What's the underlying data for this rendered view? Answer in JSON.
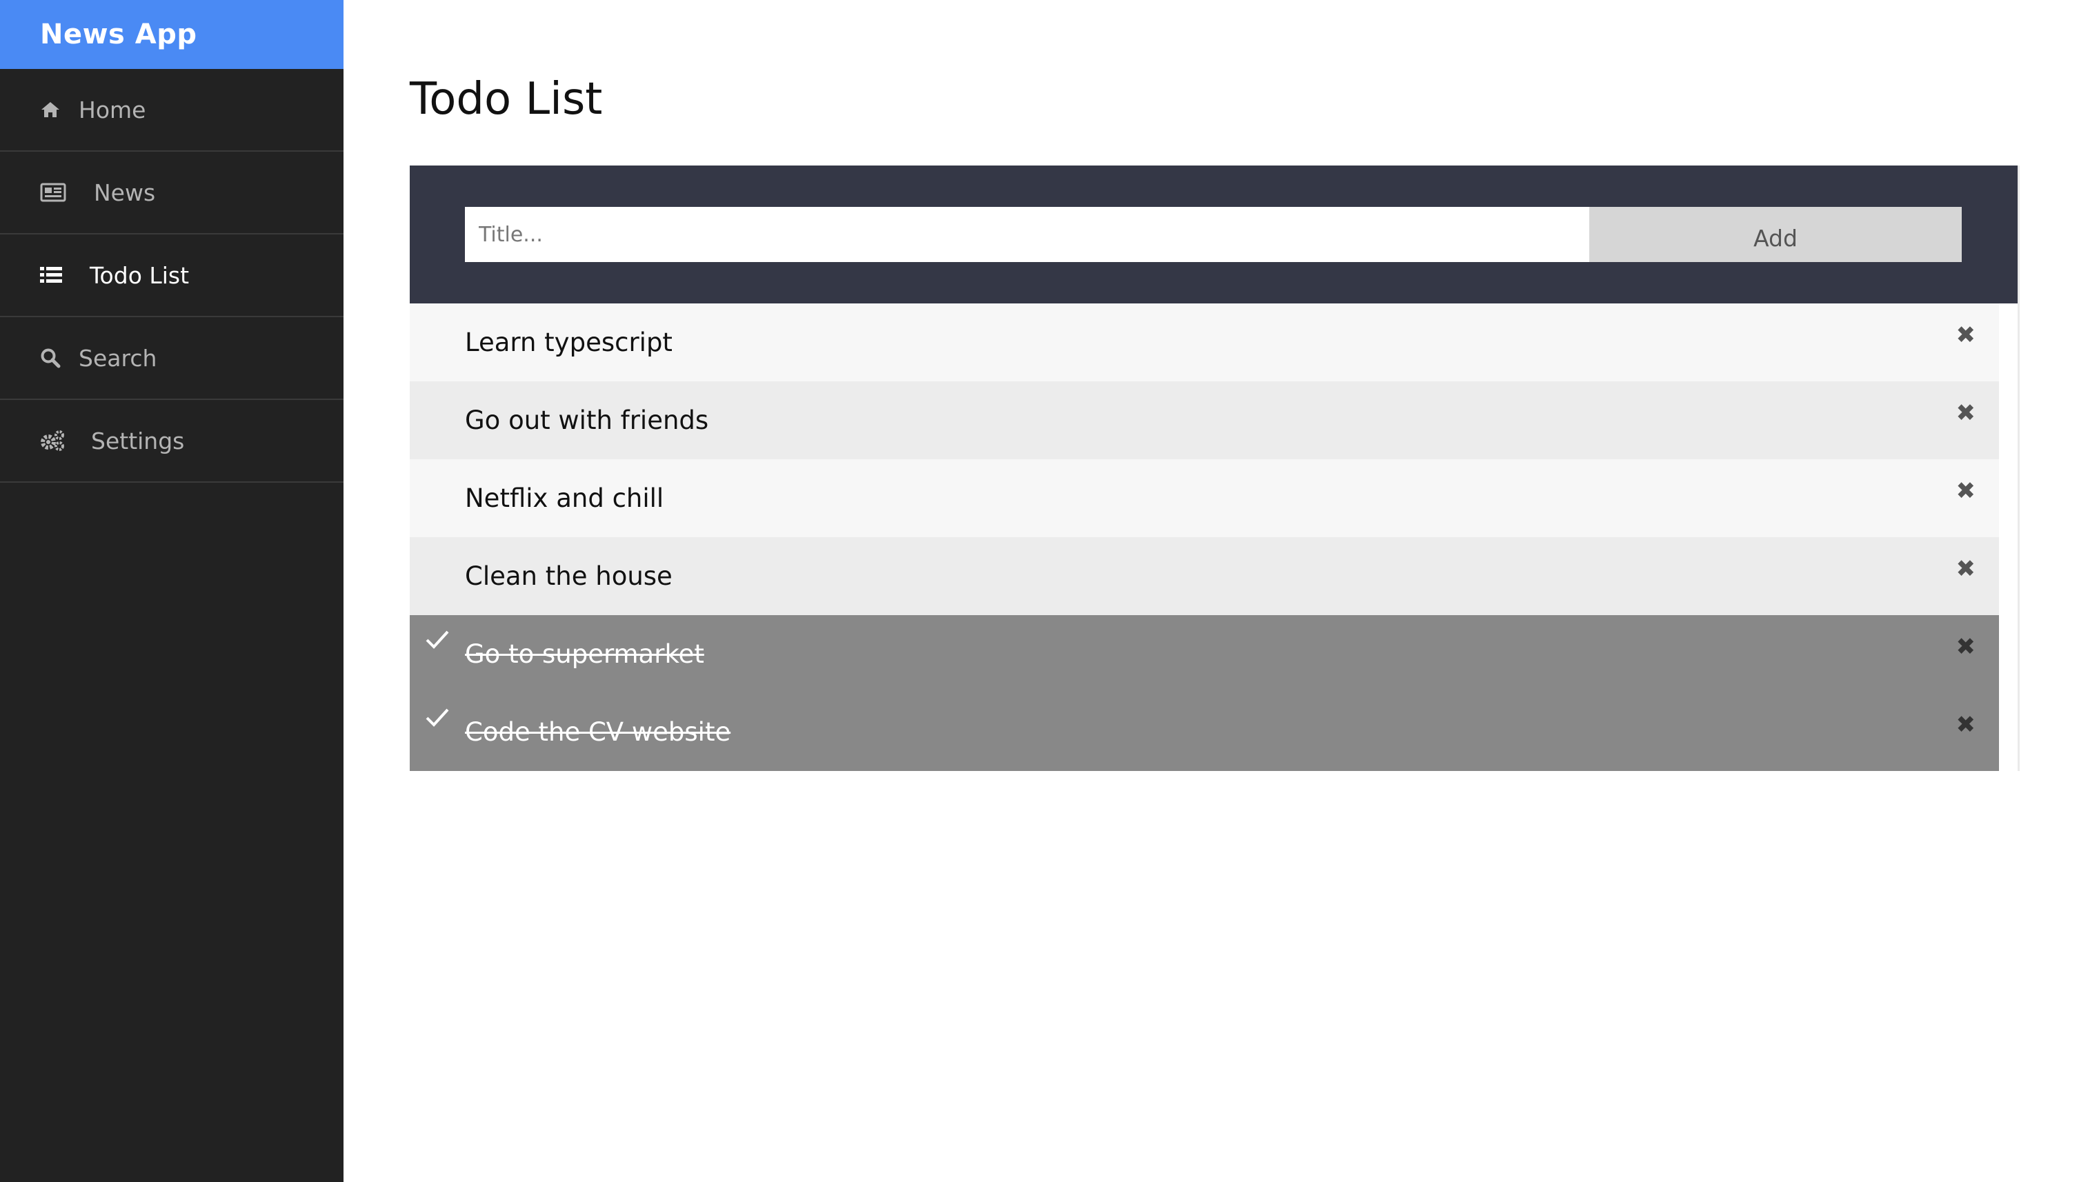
{
  "app": {
    "brand": "News App"
  },
  "sidebar": {
    "items": [
      {
        "label": "Home",
        "icon": "home-icon",
        "active": false
      },
      {
        "label": "News",
        "icon": "newspaper-icon",
        "active": false
      },
      {
        "label": "Todo List",
        "icon": "list-icon",
        "active": true
      },
      {
        "label": "Search",
        "icon": "search-icon",
        "active": false
      },
      {
        "label": "Settings",
        "icon": "gears-icon",
        "active": false
      }
    ]
  },
  "main": {
    "title": "Todo List",
    "input": {
      "placeholder": "Title...",
      "value": ""
    },
    "add_label": "Add",
    "close_glyph": "✖",
    "todos": [
      {
        "text": "Learn typescript",
        "checked": false
      },
      {
        "text": "Go out with friends",
        "checked": false
      },
      {
        "text": "Netflix and chill",
        "checked": false
      },
      {
        "text": "Clean the house",
        "checked": false
      },
      {
        "text": "Go to supermarket",
        "checked": true
      },
      {
        "text": "Code the CV website",
        "checked": true
      }
    ]
  },
  "colors": {
    "brand": "#4a8af4",
    "sidebar_bg": "#222222",
    "header_bg": "#343746",
    "checked_bg": "#888888"
  }
}
